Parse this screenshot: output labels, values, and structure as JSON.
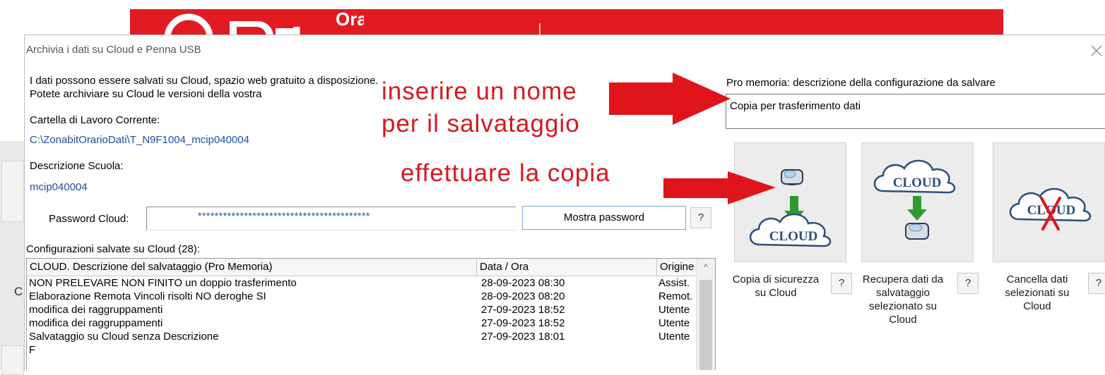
{
  "background": {
    "banner_color": "#e21b23",
    "banner_text": "Orario",
    "left_letter": "C",
    "left_letter2": "C"
  },
  "dialog": {
    "title": "Archivia i dati su Cloud e Penna USB",
    "close_icon": "close-icon"
  },
  "intro": {
    "line1": "I dati possono essere salvati su Cloud, spazio web gratuito a disposizione.",
    "line2": "Potete archiviare su Cloud le versioni della vostra"
  },
  "workdir": {
    "label": "Cartella di Lavoro Corrente:",
    "value": "C:\\ZonabitOrarioDati\\T_N9F1004_mcip040004"
  },
  "school": {
    "label": "Descrizione Scuola:",
    "value": "mcip040004"
  },
  "password": {
    "label": "Password Cloud:",
    "value": "*****************************************",
    "show_button": "Mostra password",
    "help": "?"
  },
  "saved": {
    "label": "Configurazioni salvate su Cloud (28):",
    "columns": [
      "CLOUD. Descrizione del salvataggio (Pro Memoria)",
      "Data / Ora",
      "Origine"
    ],
    "rows": [
      [
        "NON PRELEVARE NON FINITO un doppio trasferimento",
        "28-09-2023 08:30",
        "Assist."
      ],
      [
        "Elaborazione Remota Vincoli risolti NO  deroghe SI",
        "28-09-2023 08:20",
        "Remot."
      ],
      [
        "modifica dei raggruppamenti",
        "27-09-2023 18:52",
        "Utente"
      ],
      [
        "modifica dei raggruppamenti",
        "27-09-2023 18:52",
        "Utente"
      ],
      [
        "Salvataggio su Cloud senza Descrizione",
        "27-09-2023 18:01",
        "Utente"
      ],
      [
        "F",
        "",
        ""
      ]
    ],
    "scroll_up_icon": "^"
  },
  "memo": {
    "label": "Pro memoria: descrizione della configurazione da salvare",
    "value": "Copia per trasferimento dati"
  },
  "actions": {
    "backup": {
      "caption1": "Copia di sicurezza",
      "caption2": "su Cloud",
      "help": "?",
      "cloud_text": "CLOUD"
    },
    "restore": {
      "caption1": "Recupera dati da",
      "caption2": "salvataggio",
      "caption3": "selezionato su",
      "caption4": "Cloud",
      "help": "?",
      "cloud_text": "CLOUD"
    },
    "delete": {
      "caption1": "Cancella dati",
      "caption2": "selezionati su",
      "caption3": "Cloud",
      "help": "?",
      "cloud_text": "CLOUD"
    }
  },
  "annotations": {
    "line1": "inserire un nome",
    "line2": "per il salvataggio",
    "line3": "effettuare la copia",
    "color": "#d41920"
  }
}
